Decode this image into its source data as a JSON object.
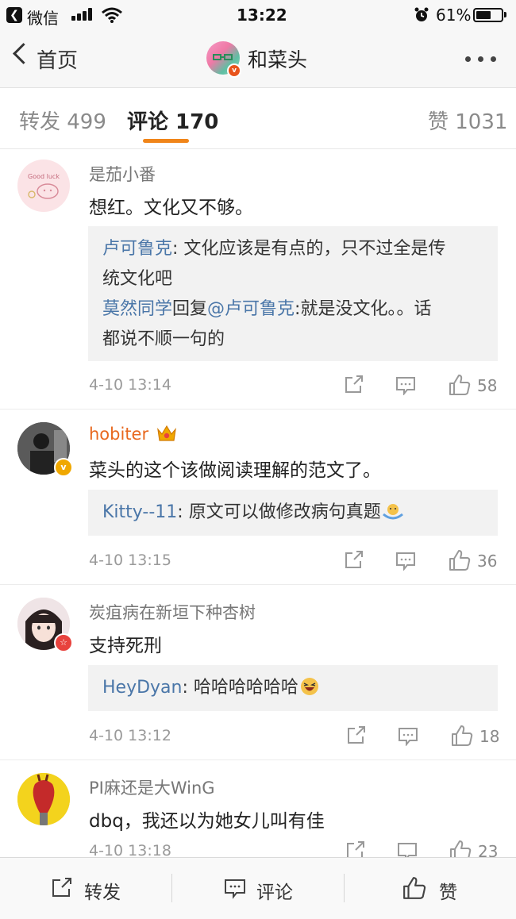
{
  "status_bar": {
    "back_app": "微信",
    "time": "13:22",
    "battery": "61%",
    "battery_level": 0.61
  },
  "nav": {
    "back_label": "首页",
    "title": "和菜头"
  },
  "tabs": [
    {
      "label": "转发 499"
    },
    {
      "label": "评论 170"
    },
    {
      "label": "赞 1031"
    }
  ],
  "comments": [
    {
      "name": "是茄小番",
      "text": "想红。文化又不够。",
      "avatar_text": "Good luck",
      "replies": [
        {
          "user": "卢可鲁克",
          "sep": ": ",
          "content": "文化应该是有点的，只不过全是传",
          "content2": "统文化吧"
        },
        {
          "user": "莫然同学",
          "sep": "回复",
          "mention": "@卢可鲁克",
          "content": ":就是没文化。。话",
          "content2": "都说不顺一句的"
        }
      ],
      "time": "4-10 13:14",
      "likes": "58"
    },
    {
      "name": "hobiter",
      "text": "菜头的这个该做阅读理解的范文了。",
      "replies": [
        {
          "user": "Kitty--11",
          "sep": ": ",
          "content": "原文可以做修改病句真题"
        }
      ],
      "time": "4-10 13:15",
      "likes": "36"
    },
    {
      "name": "炭疽病在新垣下种杏树",
      "text": "支持死刑",
      "replies": [
        {
          "user": "HeyDyan",
          "sep": ": ",
          "content": "哈哈哈哈哈哈"
        }
      ],
      "time": "4-10 13:12",
      "likes": "18"
    },
    {
      "name": "PI麻还是大WinG",
      "text": "dbq，我还以为她女儿叫有佳",
      "time": "4-10 13:18",
      "likes": "23"
    }
  ],
  "bottom_bar": {
    "repost": "转发",
    "comment": "评论",
    "like": "赞"
  },
  "colors": {
    "accent": "#f08519",
    "link": "#4a76a8",
    "name_highlight": "#e8681f"
  }
}
